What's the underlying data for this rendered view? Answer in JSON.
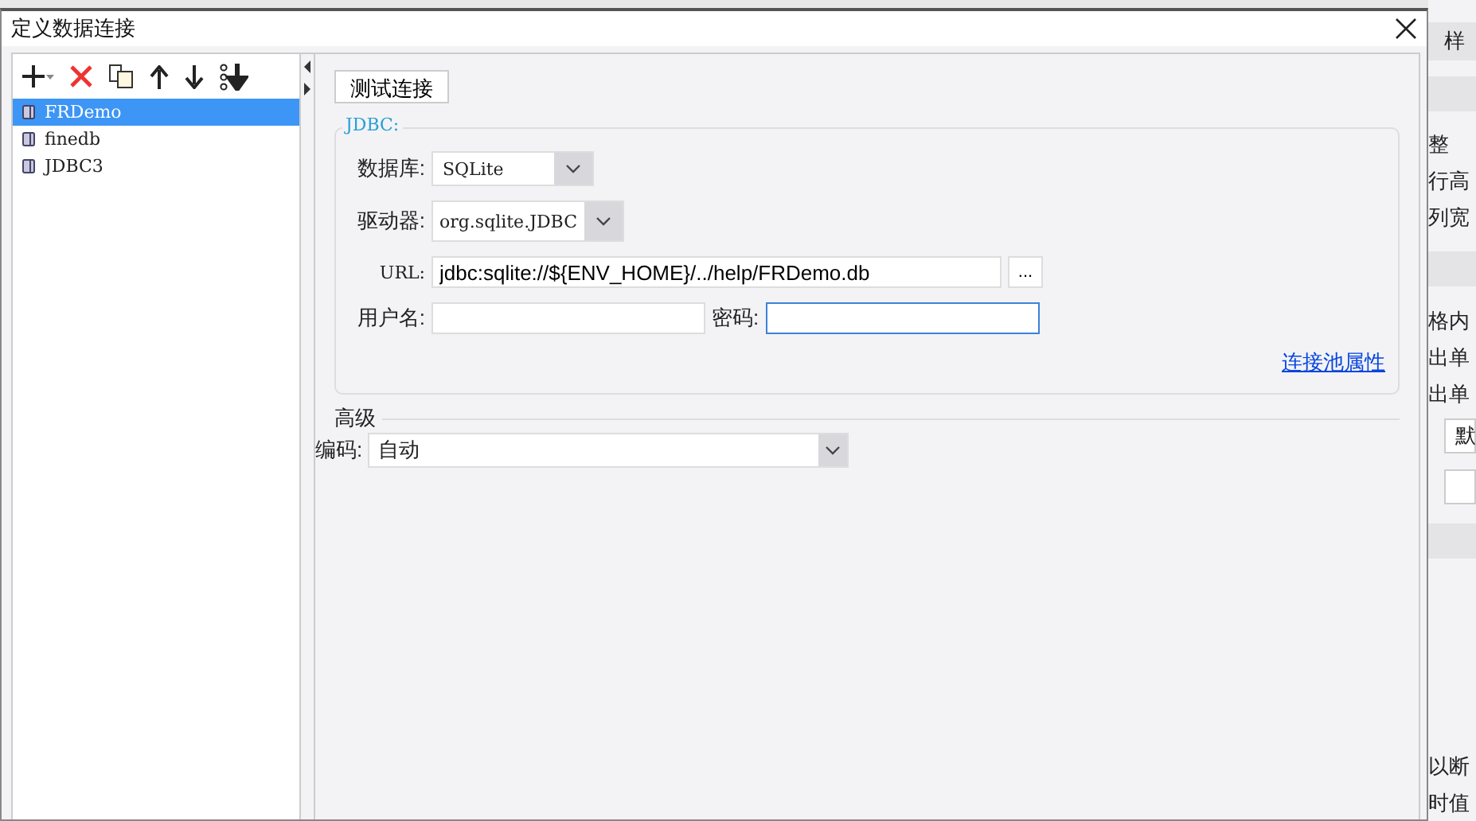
{
  "window": {
    "title": "定义数据连接"
  },
  "toolbar": [
    {
      "kind": "add"
    },
    {
      "kind": "delete"
    },
    {
      "kind": "copy"
    },
    {
      "kind": "up"
    },
    {
      "kind": "down"
    },
    {
      "kind": "sort"
    }
  ],
  "connections": [
    {
      "label": "FRDemo",
      "selected": true
    },
    {
      "label": "finedb",
      "selected": false
    },
    {
      "label": "JDBC3",
      "selected": false
    }
  ],
  "test_button": "测试连接",
  "jdbc": {
    "legend": "JDBC:",
    "database_label": "数据库:",
    "database": "SQLite",
    "driver_label": "驱动器:",
    "driver": "org.sqlite.JDBC",
    "url_label": "URL:",
    "url": "jdbc:sqlite://${ENV_HOME}/../help/FRDemo.db",
    "browse_button": "...",
    "username_label": "用户名:",
    "password_label": "密码:",
    "pool_link": "连接池属性"
  },
  "advanced": {
    "legend": "高级",
    "encoding_label": "编码:",
    "encoding": "自动"
  },
  "background_panel": {
    "tab": "样",
    "lines": [
      "整",
      "行高",
      "列宽",
      "格内",
      "出单",
      "出单"
    ],
    "select": "默",
    "lines_2": [
      "以断",
      "时值"
    ]
  }
}
